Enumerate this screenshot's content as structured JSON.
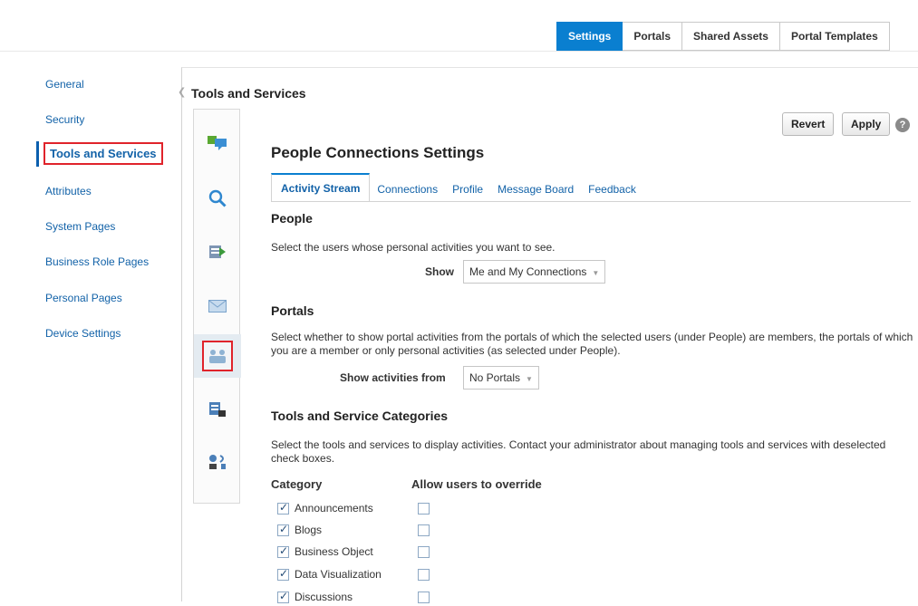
{
  "top_tabs": [
    {
      "label": "Settings",
      "active": true
    },
    {
      "label": "Portals",
      "active": false
    },
    {
      "label": "Shared Assets",
      "active": false
    },
    {
      "label": "Portal Templates",
      "active": false
    }
  ],
  "left_nav": [
    {
      "label": "General"
    },
    {
      "label": "Security"
    },
    {
      "label": "Tools and Services",
      "selected": true
    },
    {
      "label": "Attributes"
    },
    {
      "label": "System Pages"
    },
    {
      "label": "Business Role Pages"
    },
    {
      "label": "Personal Pages"
    },
    {
      "label": "Device Settings"
    }
  ],
  "panel": {
    "title": "Tools and Services",
    "section_title": "People Connections Settings",
    "revert_label": "Revert",
    "apply_label": "Apply",
    "help_glyph": "?"
  },
  "icon_strip": [
    {
      "name": "discussions-icon",
      "selected": false
    },
    {
      "name": "search-icon",
      "selected": false
    },
    {
      "name": "export-icon",
      "selected": false
    },
    {
      "name": "mail-icon",
      "selected": false
    },
    {
      "name": "people-connections-icon",
      "selected": true
    },
    {
      "name": "documents-icon",
      "selected": false
    },
    {
      "name": "workflow-icon",
      "selected": false
    }
  ],
  "sub_tabs": [
    {
      "label": "Activity Stream",
      "active": true
    },
    {
      "label": "Connections"
    },
    {
      "label": "Profile"
    },
    {
      "label": "Message Board"
    },
    {
      "label": "Feedback"
    }
  ],
  "people": {
    "heading": "People",
    "description": "Select the users whose personal activities you want to see.",
    "show_label": "Show",
    "show_value": "Me and My Connections"
  },
  "portals": {
    "heading": "Portals",
    "description": "Select whether to show portal activities from the portals of which the selected users (under People) are members, the portals of which you are a member or only personal activities (as selected under People).",
    "show_label": "Show activities from",
    "show_value": "No Portals"
  },
  "categories": {
    "heading": "Tools and Service Categories",
    "description": "Select the tools and services to display activities. Contact your administrator about managing tools and services with deselected check boxes.",
    "col_category": "Category",
    "col_override": "Allow users to override",
    "items": [
      {
        "label": "Announcements",
        "checked": true,
        "override": false
      },
      {
        "label": "Blogs",
        "checked": true,
        "override": false
      },
      {
        "label": "Business Object",
        "checked": true,
        "override": false
      },
      {
        "label": "Data Visualization",
        "checked": true,
        "override": false
      },
      {
        "label": "Discussions",
        "checked": true,
        "override": false
      }
    ]
  },
  "colors": {
    "accent": "#0a7fd0",
    "link": "#1262a8",
    "highlight": "#e0232b"
  }
}
